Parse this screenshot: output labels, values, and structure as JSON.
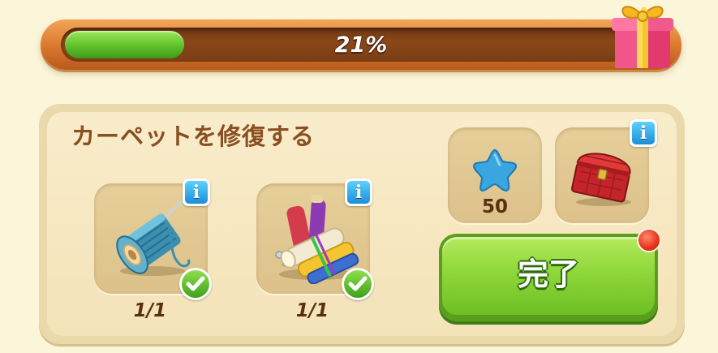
{
  "progress": {
    "percent_label": "21%",
    "fraction": 0.21,
    "fill_color": "#5fc12a"
  },
  "panel": {
    "title": "カーペットを修復する"
  },
  "ingredients": [
    {
      "name": "thread-spool-icon",
      "count": "1/1",
      "completed": true
    },
    {
      "name": "fabric-rolls-icon",
      "count": "1/1",
      "completed": true
    }
  ],
  "rewards": {
    "stars": {
      "icon": "blue-star-icon",
      "value": "50"
    },
    "chest": {
      "icon": "red-chest-icon"
    }
  },
  "complete_button": {
    "label": "完了",
    "has_notification": true
  },
  "icons": {
    "info": "i"
  }
}
